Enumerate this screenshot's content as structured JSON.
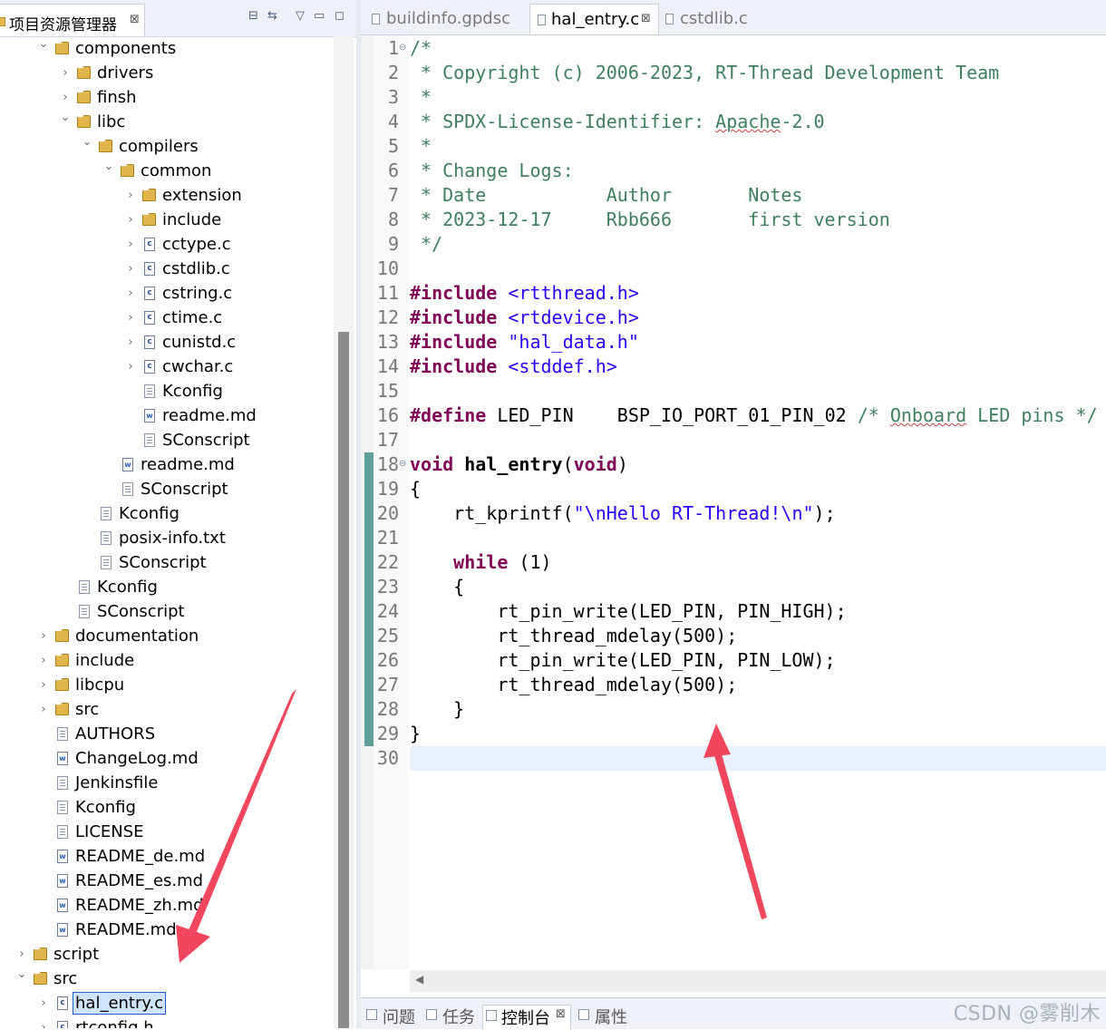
{
  "explorer": {
    "title": "项目资源管理器",
    "tree": [
      {
        "label": "components",
        "type": "folder",
        "expanded": true
      },
      {
        "label": "drivers",
        "type": "folder",
        "expanded": false
      },
      {
        "label": "finsh",
        "type": "folder",
        "expanded": false
      },
      {
        "label": "libc",
        "type": "folder",
        "expanded": true
      },
      {
        "label": "compilers",
        "type": "folder",
        "expanded": true
      },
      {
        "label": "common",
        "type": "folder",
        "expanded": true
      },
      {
        "label": "extension",
        "type": "folder",
        "expanded": false
      },
      {
        "label": "include",
        "type": "folder",
        "expanded": false
      },
      {
        "label": "cctype.c",
        "type": "c-file"
      },
      {
        "label": "cstdlib.c",
        "type": "c-file"
      },
      {
        "label": "cstring.c",
        "type": "c-file"
      },
      {
        "label": "ctime.c",
        "type": "c-file"
      },
      {
        "label": "cunistd.c",
        "type": "c-file"
      },
      {
        "label": "cwchar.c",
        "type": "c-file"
      },
      {
        "label": "Kconfig",
        "type": "file"
      },
      {
        "label": "readme.md",
        "type": "md-file"
      },
      {
        "label": "SConscript",
        "type": "file"
      },
      {
        "label": "readme.md",
        "type": "md-file"
      },
      {
        "label": "SConscript",
        "type": "file"
      },
      {
        "label": "Kconfig",
        "type": "file"
      },
      {
        "label": "posix-info.txt",
        "type": "file"
      },
      {
        "label": "SConscript",
        "type": "file"
      },
      {
        "label": "Kconfig",
        "type": "file"
      },
      {
        "label": "SConscript",
        "type": "file"
      },
      {
        "label": "documentation",
        "type": "folder",
        "expanded": false
      },
      {
        "label": "include",
        "type": "folder",
        "expanded": false
      },
      {
        "label": "libcpu",
        "type": "folder",
        "expanded": false
      },
      {
        "label": "src",
        "type": "folder",
        "expanded": false
      },
      {
        "label": "AUTHORS",
        "type": "file"
      },
      {
        "label": "ChangeLog.md",
        "type": "md-file"
      },
      {
        "label": "Jenkinsfile",
        "type": "file"
      },
      {
        "label": "Kconfig",
        "type": "file"
      },
      {
        "label": "LICENSE",
        "type": "file"
      },
      {
        "label": "README_de.md",
        "type": "md-file"
      },
      {
        "label": "README_es.md",
        "type": "md-file"
      },
      {
        "label": "README_zh.md",
        "type": "md-file"
      },
      {
        "label": "README.md",
        "type": "md-file"
      },
      {
        "label": "script",
        "type": "folder",
        "expanded": false
      },
      {
        "label": "src",
        "type": "folder",
        "expanded": true
      },
      {
        "label": "hal_entry.c",
        "type": "c-file",
        "selected": true
      },
      {
        "label": "rtconfig.h",
        "type": "c-file"
      }
    ]
  },
  "editor": {
    "tabs": [
      {
        "label": "buildinfo.gpdsc",
        "active": false
      },
      {
        "label": "hal_entry.c",
        "active": true
      },
      {
        "label": "cstdlib.c",
        "active": false
      }
    ],
    "line_numbers": [
      "1",
      "2",
      "3",
      "4",
      "5",
      "6",
      "7",
      "8",
      "9",
      "10",
      "11",
      "12",
      "13",
      "14",
      "15",
      "16",
      "17",
      "18",
      "19",
      "20",
      "21",
      "22",
      "23",
      "24",
      "25",
      "26",
      "27",
      "28",
      "29",
      "30"
    ],
    "code": {
      "l1": "/*",
      "l2": " * Copyright (c) 2006-2023, RT-Thread Development Team",
      "l3": " *",
      "l4a": " * SPDX-License-Identifier: ",
      "l4b": "Apache",
      "l4c": "-2.0",
      "l5": " *",
      "l6": " * Change Logs:",
      "l7": " * Date           Author       Notes",
      "l8": " * 2023-12-17     Rbb666       first version",
      "l9": " */",
      "inc_kw": "#include",
      "l11": " <rtthread.h>",
      "l12": " <rtdevice.h>",
      "l13": " \"hal_data.h\"",
      "l14": " <stddef.h>",
      "def_kw": "#define",
      "l16a": " LED_PIN    BSP_IO_PORT_01_PIN_02 ",
      "l16b": "/* ",
      "l16c": "Onboard",
      "l16d": " LED pins */",
      "void_kw": "void",
      "l18fn": " hal_entry",
      "l18a": "(",
      "l18b": ")",
      "l19": "{",
      "l20a": "    rt_kprintf(",
      "l20b": "\"\\nHello RT-Thread!\\n\"",
      "l20c": ");",
      "while_kw": "while",
      "l22pre": "    ",
      "l22a": " (1)",
      "l23": "    {",
      "l24": "        rt_pin_write(LED_PIN, PIN_HIGH);",
      "l25": "        rt_thread_mdelay(500);",
      "l26": "        rt_pin_write(LED_PIN, PIN_LOW);",
      "l27": "        rt_thread_mdelay(500);",
      "l28": "    }",
      "l29": "}"
    }
  },
  "bottom_panel": {
    "tabs": [
      {
        "label": "问题",
        "active": false
      },
      {
        "label": "任务",
        "active": false
      },
      {
        "label": "控制台",
        "active": true
      },
      {
        "label": "属性",
        "active": false
      }
    ]
  },
  "watermark": "CSDN @雾削木",
  "colors": {
    "keyword": "#7f0055",
    "comment": "#3f7f5f",
    "string": "#2a00ff",
    "arrow": "#f0475f",
    "selection": "#cfe3fb"
  }
}
